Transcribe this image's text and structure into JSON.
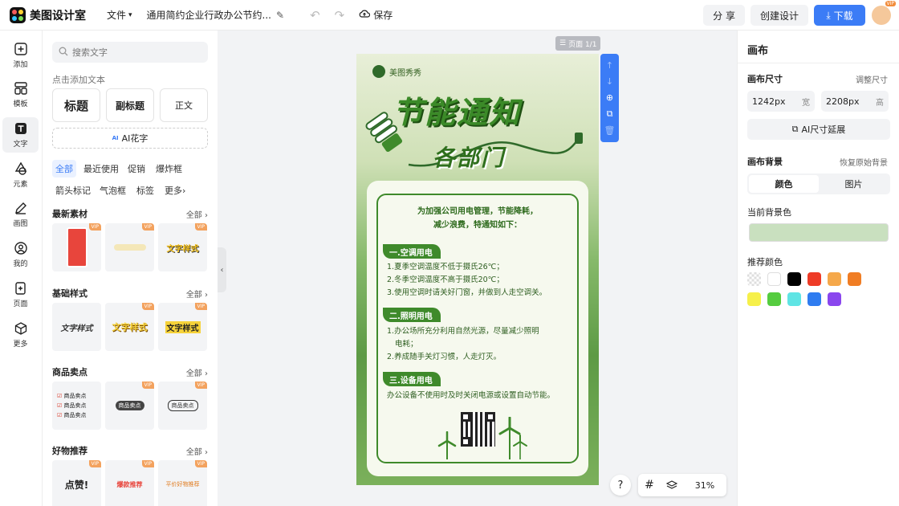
{
  "app": {
    "name": "美图设计室"
  },
  "topbar": {
    "file_menu": "文件",
    "doc_title": "通用简约企业行政办公节约...",
    "save_label": "保存",
    "share_label": "分 享",
    "create_label": "创建设计",
    "download_label": "下载",
    "avatar_badge": "VIP"
  },
  "rail": {
    "items": [
      {
        "label": "添加",
        "icon": "plus-square-icon"
      },
      {
        "label": "模板",
        "icon": "template-icon"
      },
      {
        "label": "文字",
        "icon": "text-icon"
      },
      {
        "label": "元素",
        "icon": "shapes-icon"
      },
      {
        "label": "画图",
        "icon": "pen-icon"
      },
      {
        "label": "我的",
        "icon": "user-icon"
      },
      {
        "label": "页面",
        "icon": "page-add-icon"
      },
      {
        "label": "更多",
        "icon": "cube-icon"
      }
    ]
  },
  "text_panel": {
    "search_placeholder": "搜索文字",
    "click_add_label": "点击添加文本",
    "btn_heading": "标题",
    "btn_subheading": "副标题",
    "btn_body": "正文",
    "ai_badge": "AI",
    "ai_label": "AI花字",
    "chips": [
      "全部",
      "最近使用",
      "促销",
      "爆炸框",
      "箭头标记",
      "气泡框",
      "标签",
      "更多"
    ],
    "vip_label": "VIP",
    "all_label": "全部",
    "sections": [
      {
        "title": "最新素材",
        "cards": [
          "",
          "",
          "文字样式"
        ]
      },
      {
        "title": "基础样式",
        "cards": [
          "文字样式",
          "文字样式",
          "文字样式"
        ]
      },
      {
        "title": "商品卖点",
        "cards": [
          "商品卖点",
          "商品卖点",
          "商品卖点"
        ]
      },
      {
        "title": "好物推荐",
        "cards": [
          "点赞!",
          "爆款推荐",
          "平价好物推荐"
        ]
      }
    ]
  },
  "canvas": {
    "page_label": "页面 1/1",
    "zoom": "31%",
    "help": "?"
  },
  "poster": {
    "brand": "美图秀秀",
    "title": "节能通知",
    "subtitle": "各部门",
    "intro_line1": "为加强公司用电管理，节能降耗，",
    "intro_line2": "减少浪费，特通知如下：",
    "sec1_title": "一.空调用电",
    "sec1_lines": [
      "1.夏季空调温度不低于摄氏26℃；",
      "2.冬季空调温度不高于摄氏20℃；",
      "3.使用空调时请关好门窗，并做到人走空调关。"
    ],
    "sec2_title": "二.照明用电",
    "sec2_lines": [
      "1.办公场所充分利用自然光源，尽量减少照明",
      "电耗；",
      "2.养成随手关灯习惯，人走灯灭。"
    ],
    "sec3_title": "三.设备用电",
    "sec3_lines": [
      "办公设备不使用时及时关闭电源或设置自动节能。"
    ]
  },
  "right_panel": {
    "title": "画布",
    "size_label": "画布尺寸",
    "adjust_size": "调整尺寸",
    "width_value": "1242px",
    "width_unit": "宽",
    "height_value": "2208px",
    "height_unit": "高",
    "ai_extend": "AI尺寸延展",
    "bg_label": "画布背景",
    "restore_bg": "恢复原始背景",
    "tab_color": "颜色",
    "tab_image": "图片",
    "current_bg_label": "当前背景色",
    "current_bg_color": "#c9e0bf",
    "recommended_label": "推荐颜色",
    "swatches": [
      "transparent",
      "#ffffff",
      "#000000",
      "#ee3b26",
      "#f5a84a",
      "#f07d24",
      "#f6f04a",
      "#55cc3f",
      "#5fe4e4",
      "#2f7cf0",
      "#8a46ee"
    ]
  },
  "colors": {
    "accent": "#3b7cf6",
    "poster_green": "#3f8a2b",
    "vip": "#f3a25e"
  }
}
